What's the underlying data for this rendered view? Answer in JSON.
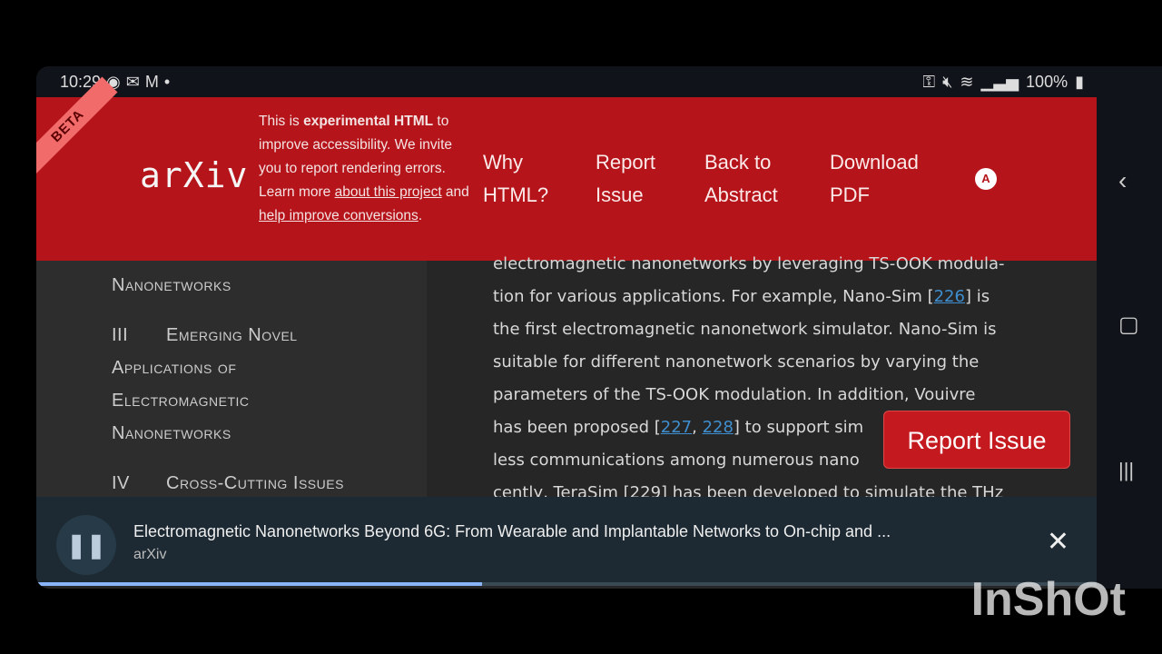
{
  "status": {
    "time": "10:29",
    "battery": "100%",
    "icons": [
      "app-icon",
      "message-icon",
      "gmail-icon",
      "dot",
      "key-icon",
      "mute-icon",
      "wifi-icon",
      "signal-icon",
      "battery-icon"
    ]
  },
  "banner": {
    "beta": "BETA",
    "logo": "arXiv",
    "notice_pre": "This is ",
    "notice_bold": "experimental HTML",
    "notice_mid": " to improve accessibility. We invite you to report rendering errors. Learn more ",
    "link1": "about this project",
    "and": " and ",
    "link2": "help improve conversions",
    "end": ".",
    "nav": [
      "Why HTML?",
      "Report Issue",
      "Back to Abstract",
      "Download PDF"
    ],
    "access_icon": "A",
    "color": "#b5141a"
  },
  "sidebar": {
    "items": [
      "Nanonetworks",
      "III",
      "Emerging Novel",
      "Applications of",
      "Electromagnetic",
      "Nanonetworks",
      "IV",
      "Cross-Cutting Issues"
    ]
  },
  "main": {
    "l1": "electromagnetic nanonetworks by leveraging TS-OOK modula-",
    "l2a": "tion for various applications. For example, Nano-Sim [",
    "r226": "226",
    "l2b": "] is",
    "l3": "the first electromagnetic nanonetwork simulator. Nano-Sim is",
    "l4": "suitable for different nanonetwork scenarios by varying the",
    "l5": "parameters of the TS-OOK modulation. In addition, Vouivre",
    "l6a": "has been proposed [",
    "r227": "227",
    "comma": ", ",
    "r228": "228",
    "l6b": "] to support sim",
    "l7": "less communications among numerous nano",
    "l8": "cently, TeraSim [229] has been developed to simulate the THz"
  },
  "report_button": "Report Issue",
  "media": {
    "title": "Electromagnetic Nanonetworks Beyond 6G: From Wearable and Implantable Networks to On-chip and ...",
    "source": "arXiv",
    "progress": 0.42
  },
  "watermark": "InShOt"
}
